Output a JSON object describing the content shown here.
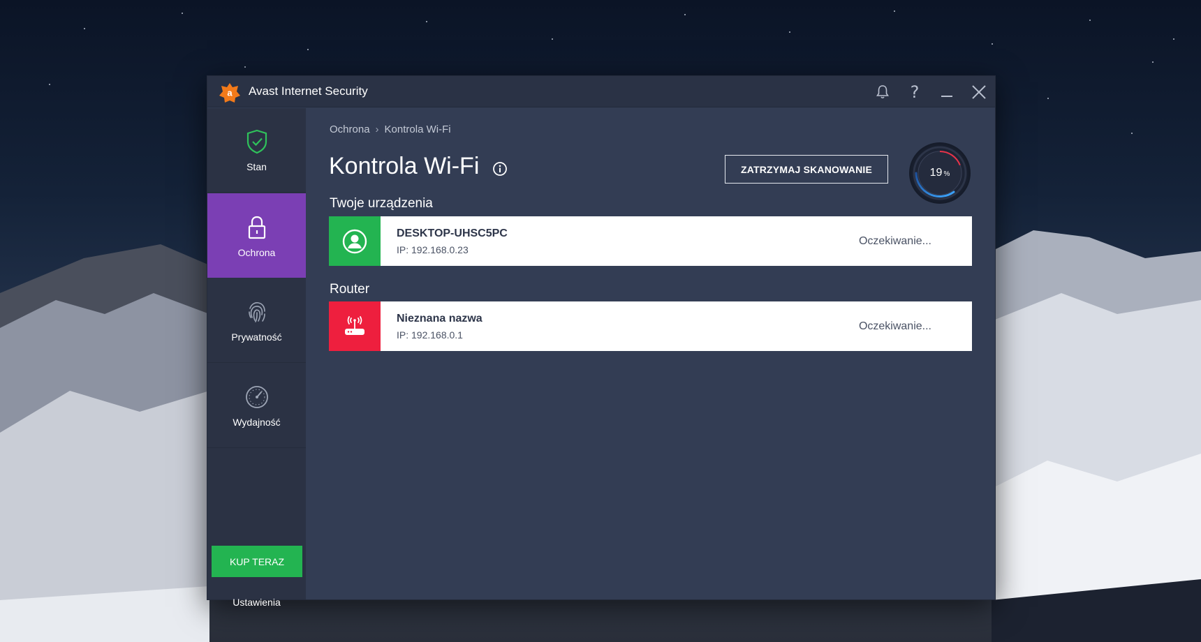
{
  "window": {
    "title": "Avast Internet Security",
    "logo_letter": "a"
  },
  "sidebar": {
    "items": [
      {
        "label": "Stan",
        "icon": "shield-check-icon"
      },
      {
        "label": "Ochrona",
        "icon": "lock-icon",
        "active": true
      },
      {
        "label": "Prywatność",
        "icon": "fingerprint-icon"
      },
      {
        "label": "Wydajność",
        "icon": "gauge-icon"
      }
    ],
    "buy_label": "KUP TERAZ",
    "settings_label": "Ustawienia"
  },
  "main": {
    "breadcrumb": [
      "Ochrona",
      "Kontrola Wi-Fi"
    ],
    "breadcrumb_sep": "›",
    "title": "Kontrola Wi-Fi",
    "stop_button": "ZATRZYMAJ SKANOWANIE",
    "progress": {
      "value": "19",
      "unit": "%",
      "fraction": 0.19
    },
    "sections": [
      {
        "title": "Twoje urządzenia",
        "device": {
          "name": "DESKTOP-UHSC5PC",
          "ip": "IP: 192.168.0.23",
          "status": "Oczekiwanie...",
          "icon": "user-icon",
          "color": "#23b451"
        }
      },
      {
        "title": "Router",
        "device": {
          "name": "Nieznana nazwa",
          "ip": "IP: 192.168.0.1",
          "status": "Oczekiwanie...",
          "icon": "router-icon",
          "color": "#ee1f3e"
        }
      }
    ]
  },
  "colors": {
    "accent_purple": "#7b3fb4",
    "buy_green": "#23b451",
    "avast_orange": "#f27a1a"
  }
}
